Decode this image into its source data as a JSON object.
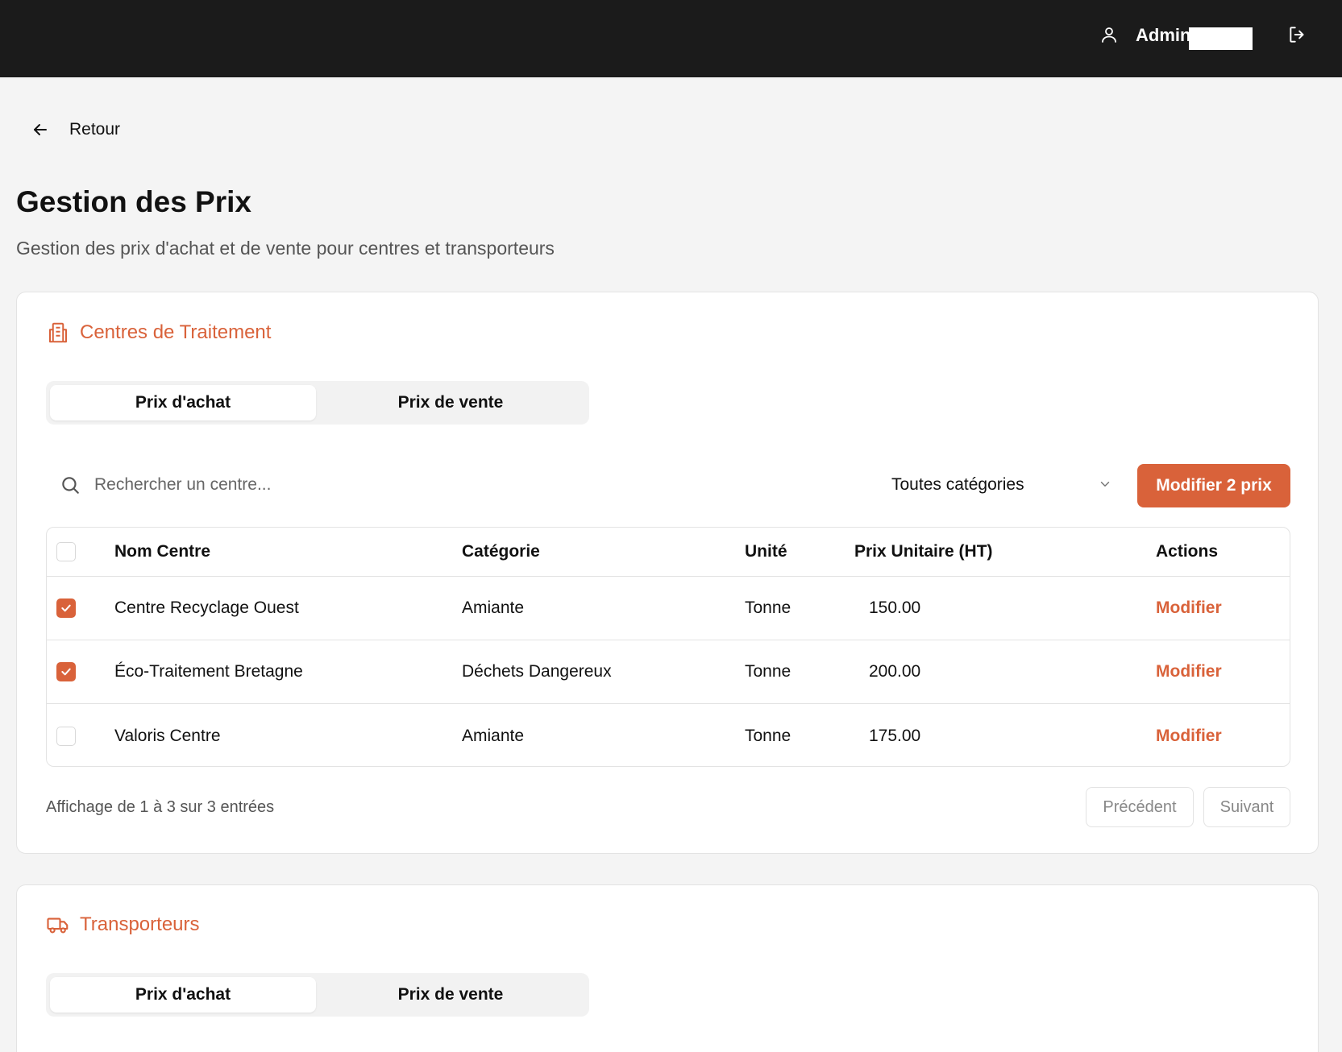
{
  "header": {
    "user_icon": "user-icon",
    "user_name": "Admin",
    "logout_icon": "logout-icon"
  },
  "nav": {
    "back_label": "Retour",
    "back_icon": "arrow-left-icon"
  },
  "page": {
    "title": "Gestion des Prix",
    "subtitle": "Gestion des prix d'achat et de vente pour centres et transporteurs"
  },
  "centres": {
    "title": "Centres de Traitement",
    "icon": "building-icon",
    "tabs": [
      "Prix d'achat",
      "Prix de vente"
    ],
    "active_tab": "Prix d'achat",
    "search_placeholder": "Rechercher un centre...",
    "category_filter": "Toutes catégories",
    "bulk_button": "Modifier 2 prix",
    "table": {
      "columns": [
        "Nom Centre",
        "Catégorie",
        "Unité",
        "Prix Unitaire (HT)",
        "Actions"
      ],
      "rows": [
        {
          "checked": true,
          "name": "Centre Recyclage Ouest",
          "category": "Amiante",
          "unit": "Tonne",
          "price": "150.00",
          "action": "Modifier"
        },
        {
          "checked": true,
          "name": "Éco-Traitement Bretagne",
          "category": "Déchets Dangereux",
          "unit": "Tonne",
          "price": "200.00",
          "action": "Modifier"
        },
        {
          "checked": false,
          "name": "Valoris Centre",
          "category": "Amiante",
          "unit": "Tonne",
          "price": "175.00",
          "action": "Modifier"
        }
      ]
    },
    "footer_text": "Affichage de 1 à 3 sur 3 entrées",
    "pagination": {
      "prev": "Précédent",
      "next": "Suivant"
    }
  },
  "transporteurs": {
    "title": "Transporteurs",
    "icon": "truck-icon",
    "tabs": [
      "Prix d'achat",
      "Prix de vente"
    ],
    "active_tab": "Prix d'achat"
  },
  "colors": {
    "accent": "#d9623a",
    "topbar": "#1b1b1b",
    "background": "#f4f4f4"
  }
}
